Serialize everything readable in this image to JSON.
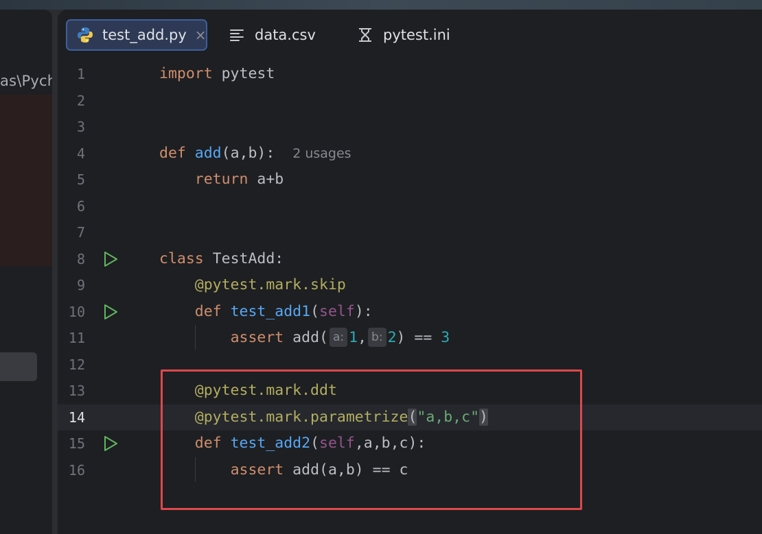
{
  "left_panel": {
    "path_fragment": "as\\Pycha"
  },
  "tabs": [
    {
      "label": "test_add.py",
      "icon": "python-icon",
      "active": true,
      "close": "×"
    },
    {
      "label": "data.csv",
      "icon": "text-lines-icon",
      "active": false
    },
    {
      "label": "pytest.ini",
      "icon": "ini-config-icon",
      "active": false
    }
  ],
  "gutter": {
    "line_numbers": [
      "1",
      "2",
      "3",
      "4",
      "5",
      "6",
      "7",
      "8",
      "9",
      "10",
      "11",
      "12",
      "13",
      "14",
      "15",
      "16"
    ]
  },
  "code": {
    "l1_import": "import",
    "l1_module": " pytest",
    "l4_def": "def",
    "l4_fn": "add",
    "l4_rest": "(a,b):",
    "l4_usages": "2 usages",
    "l5_return": "return",
    "l5_rest": " a+b",
    "l8_class": "class",
    "l8_rest": " TestAdd:",
    "l9_decorator": "@pytest.mark.skip",
    "l10_def": "def",
    "l10_fn": "test_add1",
    "l10_open": "(",
    "l10_self": "self",
    "l10_close": "):",
    "l11_assert": "assert",
    "l11_call": " add(",
    "l11_hint_a": "a:",
    "l11_val1": "1",
    "l11_comma": ",",
    "l11_hint_b": "b:",
    "l11_val2": "2",
    "l11_eq": ") == ",
    "l11_val3": "3",
    "l13_decorator": "@pytest.mark.ddt",
    "l14_decorator": "@pytest.mark.parametrize",
    "l14_open": "(",
    "l14_str": "\"a,b,c\"",
    "l14_close": ")",
    "l15_def": "def",
    "l15_fn": "test_add2",
    "l15_open": "(",
    "l15_self": "self",
    "l15_rest": ",a,b,c):",
    "l16_assert": "assert",
    "l16_rest": " add(a,b) == c"
  },
  "colors": {
    "keyword": "#cf8e6d",
    "function": "#56a8f5",
    "decorator": "#b3ae60",
    "self": "#94558d",
    "number": "#2aacb8",
    "string": "#6aab73",
    "highlight_box": "#e0484c",
    "run_icon": "#5fb85f"
  }
}
